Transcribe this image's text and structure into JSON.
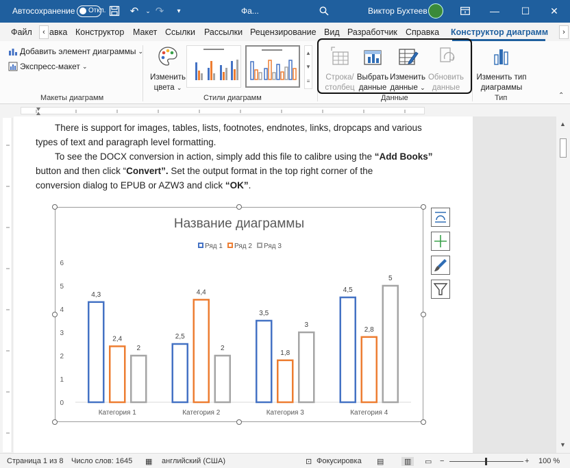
{
  "titlebar": {
    "autosave_label": "Автосохранение",
    "autosave_state": "Откл.",
    "doc_title": "Фа...",
    "user_name": "Виктор Бухтеев"
  },
  "tabs": [
    "Файл",
    "авка",
    "Конструктор",
    "Макет",
    "Ссылки",
    "Рассылки",
    "Рецензирование",
    "Вид",
    "Разработчик",
    "Справка",
    "Конструктор диаграмм"
  ],
  "ribbon": {
    "add_element": "Добавить элемент диаграммы",
    "express_layout": "Экспресс-макет",
    "change_colors": [
      "Изменить",
      "цвета"
    ],
    "group_layouts": "Макеты диаграмм",
    "group_styles": "Стили диаграмм",
    "row_col": [
      "Строка/",
      "столбец"
    ],
    "select_data": [
      "Выбрать",
      "данные"
    ],
    "edit_data": [
      "Изменить",
      "данные"
    ],
    "refresh_data": [
      "Обновить",
      "данные"
    ],
    "group_data": "Данные",
    "change_type": [
      "Изменить тип",
      "диаграммы"
    ],
    "group_type": "Тип"
  },
  "document": {
    "p1_line1": "There is support for images, tables, lists, footnotes, endnotes, links, dropcaps and various",
    "p1_line2": "types of text and paragraph level formatting.",
    "p2_line1_a": "To see the DOCX conversion in action, simply add this file to calibre using the ",
    "p2_line1_b": "“Add Books”",
    "p2_line2_a": "button and then click “",
    "p2_line2_b": "Convert”.",
    "p2_line2_c": "  Set the output format in the top right corner of the",
    "p2_line3_a": "conversion dialog to EPUB or AZW3 and click ",
    "p2_line3_b": "“OK”",
    "p2_line3_c": "."
  },
  "chart_data": {
    "type": "bar",
    "title": "Название диаграммы",
    "categories": [
      "Категория 1",
      "Категория 2",
      "Категория 3",
      "Категория 4"
    ],
    "series": [
      {
        "name": "Ряд 1",
        "values": [
          4.3,
          2.5,
          3.5,
          4.5
        ],
        "labels": [
          "4,3",
          "2,5",
          "3,5",
          "4,5"
        ],
        "color": "#4472c4"
      },
      {
        "name": "Ряд 2",
        "values": [
          2.4,
          4.4,
          1.8,
          2.8
        ],
        "labels": [
          "2,4",
          "4,4",
          "1,8",
          "2,8"
        ],
        "color": "#ed7d31"
      },
      {
        "name": "Ряд 3",
        "values": [
          2,
          2,
          3,
          5
        ],
        "labels": [
          "2",
          "2",
          "3",
          "5"
        ],
        "color": "#a5a5a5"
      }
    ],
    "yticks": [
      "0",
      "1",
      "2",
      "3",
      "4",
      "5",
      "6"
    ],
    "ylim": [
      0,
      6
    ],
    "legend": "top",
    "grid": false
  },
  "statusbar": {
    "page": "Страница 1 из 8",
    "words": "Число слов: 1645",
    "language": "английский (США)",
    "focus": "Фокусировка",
    "zoom": "100 %"
  }
}
